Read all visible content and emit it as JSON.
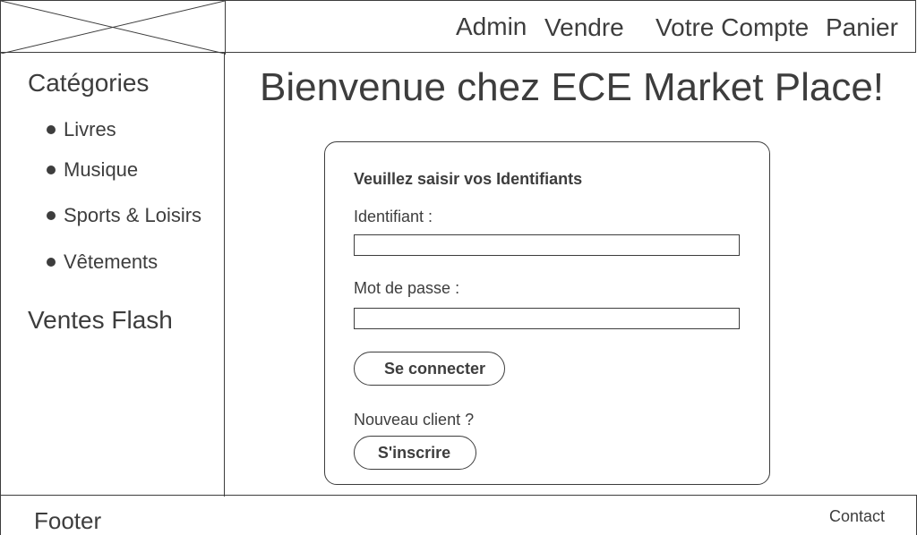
{
  "header": {
    "logo_placeholder": "logo-placeholder",
    "nav": {
      "admin": "Admin",
      "sell": "Vendre",
      "account": "Votre Compte",
      "cart": "Panier"
    }
  },
  "sidebar": {
    "categories_title": "Catégories",
    "items": [
      {
        "label": "Livres"
      },
      {
        "label": "Musique"
      },
      {
        "label": "Sports & Loisirs"
      },
      {
        "label": "Vêtements"
      }
    ],
    "flash_sales_title": "Ventes Flash"
  },
  "main": {
    "welcome_title": "Bienvenue chez ECE Market Place!",
    "login": {
      "heading": "Veuillez saisir vos Identifiants",
      "username_label": "Identifiant :",
      "username_value": "",
      "password_label": "Mot de passe :",
      "password_value": "",
      "connect_button": "Se connecter",
      "new_client_label": "Nouveau client ?",
      "register_button": "S'inscrire"
    }
  },
  "footer": {
    "title": "Footer",
    "contact": "Contact"
  },
  "colors": {
    "text": "#3d3d3d",
    "border": "#3d3d3d",
    "background": "#ffffff"
  }
}
